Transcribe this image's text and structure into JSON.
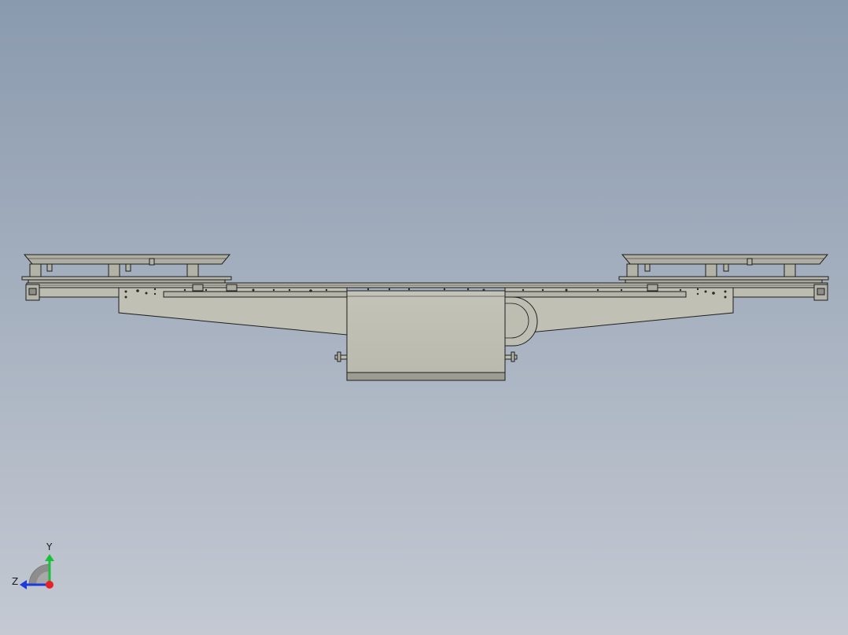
{
  "viewport": {
    "background_top": "#8a9aae",
    "background_bottom": "#c4c9d2",
    "model_fill": "#c0c0b4",
    "model_edge": "#1e1e1e"
  },
  "triad": {
    "x_color": "#e8202a",
    "y_color": "#19c03a",
    "z_color": "#1d3bd8",
    "y_label": "Y",
    "z_label": "Z"
  }
}
